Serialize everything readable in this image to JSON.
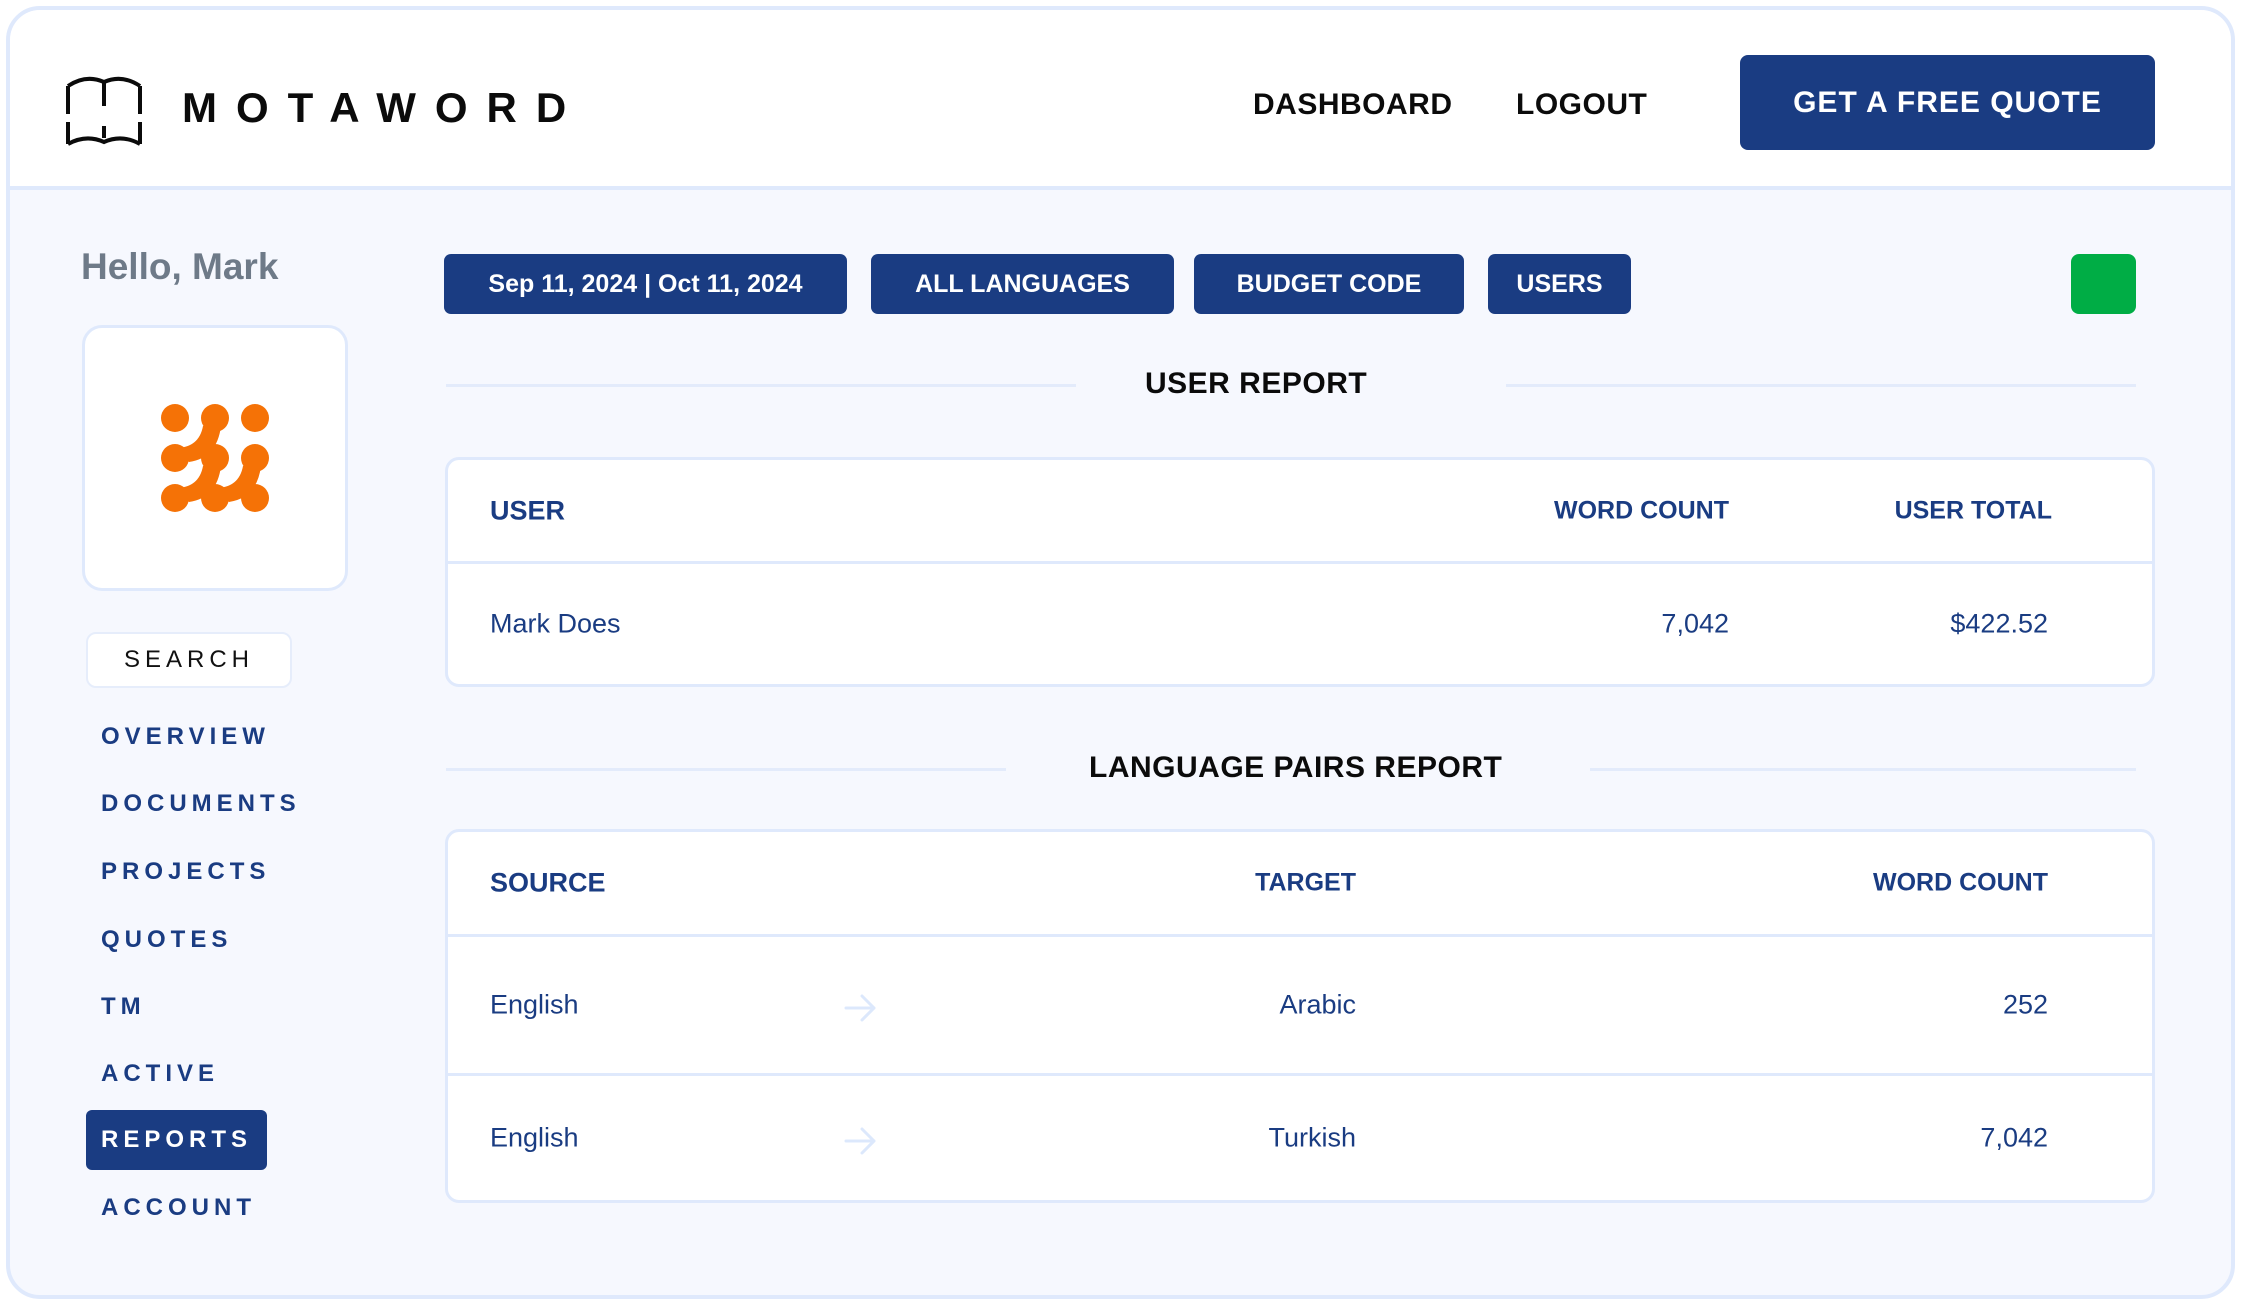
{
  "brand": {
    "name": "MOTAWORD",
    "logo_icon": "open-book-icon"
  },
  "header": {
    "nav": [
      {
        "label": "DASHBOARD"
      },
      {
        "label": "LOGOUT"
      }
    ],
    "cta_label": "GET A FREE QUOTE"
  },
  "sidebar": {
    "greeting": "Hello, Mark",
    "avatar_icon": "dot-grid-logo-icon",
    "search_label": "SEARCH",
    "items": [
      {
        "label": "OVERVIEW",
        "active": false
      },
      {
        "label": "DOCUMENTS",
        "active": false
      },
      {
        "label": "PROJECTS",
        "active": false
      },
      {
        "label": "QUOTES",
        "active": false
      },
      {
        "label": "TM",
        "active": false
      },
      {
        "label": "ACTIVE",
        "active": false
      },
      {
        "label": "REPORTS",
        "active": true
      },
      {
        "label": "ACCOUNT",
        "active": false
      }
    ]
  },
  "filters": {
    "date_range": "Sep 11, 2024 | Oct 11, 2024",
    "languages": "ALL LANGUAGES",
    "budget_code": "BUDGET CODE",
    "users": "USERS",
    "status_color": "#00ad45"
  },
  "user_report": {
    "title": "USER REPORT",
    "columns": [
      "USER",
      "WORD COUNT",
      "USER TOTAL"
    ],
    "rows": [
      {
        "user": "Mark Does",
        "word_count": "7,042",
        "user_total": "$422.52"
      }
    ]
  },
  "language_pairs_report": {
    "title": "LANGUAGE PAIRS REPORT",
    "columns": [
      "SOURCE",
      "TARGET",
      "WORD COUNT"
    ],
    "rows": [
      {
        "source": "English",
        "target": "Arabic",
        "word_count": "252"
      },
      {
        "source": "English",
        "target": "Turkish",
        "word_count": "7,042"
      }
    ]
  },
  "colors": {
    "primary": "#1a3c82",
    "accent_orange": "#f57206",
    "border": "#dfe9fc",
    "background": "#f6f8fe"
  }
}
